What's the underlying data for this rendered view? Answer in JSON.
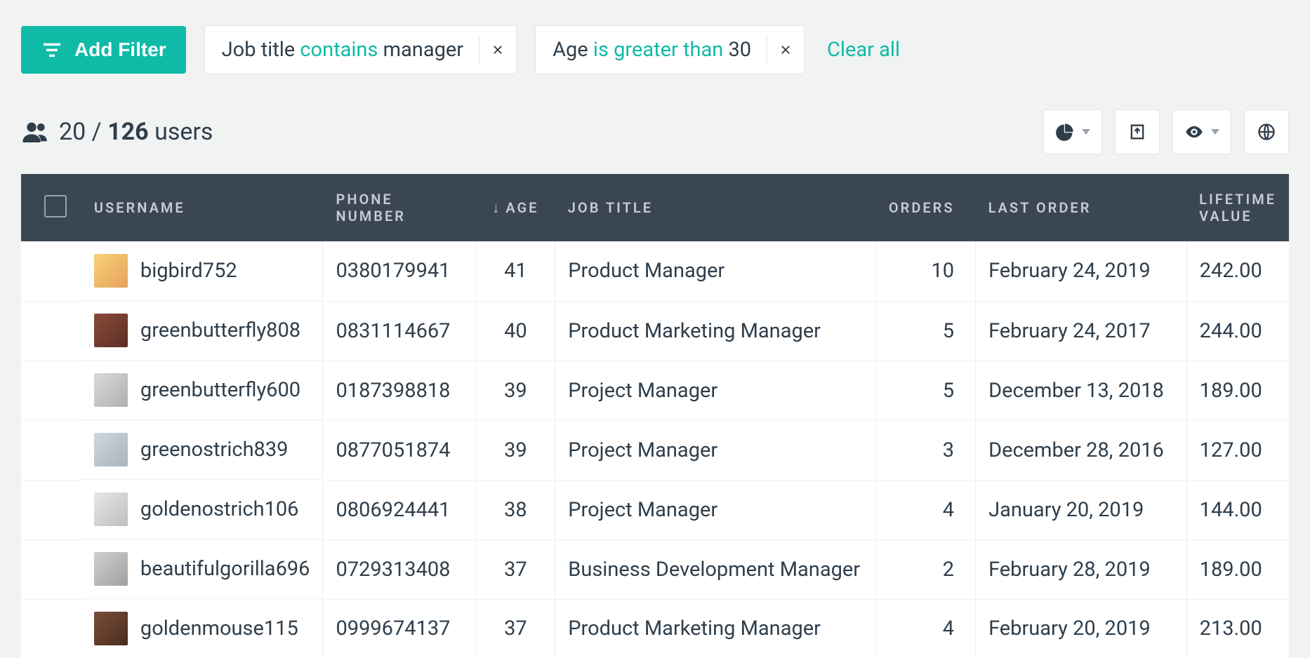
{
  "filters": {
    "add_label": "Add Filter",
    "clear_label": "Clear all",
    "pills": [
      {
        "field": "Job title",
        "operator": "contains",
        "value": "manager"
      },
      {
        "field": "Age",
        "operator": "is greater than",
        "value": "30"
      }
    ]
  },
  "counts": {
    "shown": "20",
    "sep": " / ",
    "total": "126",
    "unit": " users"
  },
  "toolbar": {
    "chart_icon": "pie-chart",
    "export_icon": "export",
    "visibility_icon": "eye",
    "globe_icon": "globe"
  },
  "table": {
    "columns": {
      "username": "USERNAME",
      "phone": "PHONE NUMBER",
      "age_sort_arrow": "↓",
      "age": "AGE",
      "job": "JOB TITLE",
      "orders": "ORDERS",
      "last_order": "LAST ORDER",
      "ltv": "LIFETIME VALUE"
    },
    "rows": [
      {
        "username": "bigbird752",
        "phone": "0380179941",
        "age": "41",
        "job": "Product Manager",
        "orders": "10",
        "last_order": "February 24, 2019",
        "ltv": "242.00"
      },
      {
        "username": "greenbutterfly808",
        "phone": "0831114667",
        "age": "40",
        "job": "Product Marketing Manager",
        "orders": "5",
        "last_order": "February 24, 2017",
        "ltv": "244.00"
      },
      {
        "username": "greenbutterfly600",
        "phone": "0187398818",
        "age": "39",
        "job": "Project Manager",
        "orders": "5",
        "last_order": "December 13, 2018",
        "ltv": "189.00"
      },
      {
        "username": "greenostrich839",
        "phone": "0877051874",
        "age": "39",
        "job": "Project Manager",
        "orders": "3",
        "last_order": "December 28, 2016",
        "ltv": "127.00"
      },
      {
        "username": "goldenostrich106",
        "phone": "0806924441",
        "age": "38",
        "job": "Project Manager",
        "orders": "4",
        "last_order": "January 20, 2019",
        "ltv": "144.00"
      },
      {
        "username": "beautifulgorilla696",
        "phone": "0729313408",
        "age": "37",
        "job": "Business Development Manager",
        "orders": "2",
        "last_order": "February 28, 2019",
        "ltv": "189.00"
      },
      {
        "username": "goldenmouse115",
        "phone": "0999674137",
        "age": "37",
        "job": "Product Marketing Manager",
        "orders": "4",
        "last_order": "February 20, 2019",
        "ltv": "213.00"
      }
    ]
  }
}
